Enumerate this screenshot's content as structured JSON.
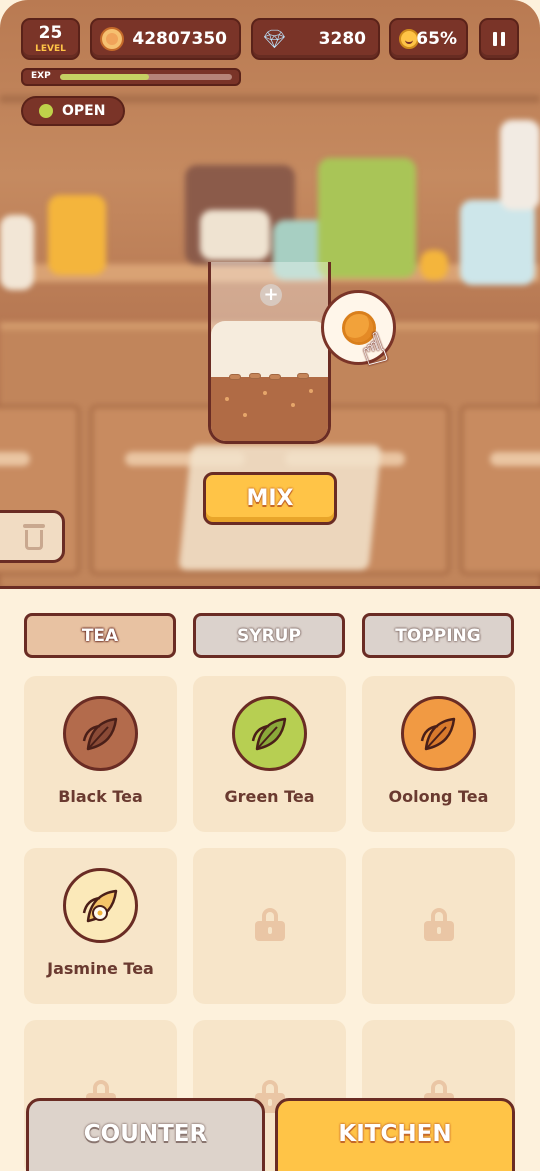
{
  "hud": {
    "level": "25",
    "level_label": "LEVEL",
    "coins": "42807350",
    "gems": "3280",
    "mood": "65%",
    "exp_label": "EXP",
    "exp_progress": 0.52
  },
  "status": {
    "open_label": "OPEN"
  },
  "station": {
    "mix_label": "MIX"
  },
  "tabs": [
    {
      "label": "TEA",
      "active": true
    },
    {
      "label": "SYRUP",
      "active": false
    },
    {
      "label": "TOPPING",
      "active": false
    }
  ],
  "ingredients": [
    {
      "label": "Black Tea",
      "icon": "black-tea-leaf-icon",
      "color": "#b36b4c",
      "locked": false
    },
    {
      "label": "Green Tea",
      "icon": "green-tea-leaf-icon",
      "color": "#b7cf52",
      "locked": false
    },
    {
      "label": "Oolong Tea",
      "icon": "oolong-tea-leaf-icon",
      "color": "#f19a43",
      "locked": false
    },
    {
      "label": "Jasmine Tea",
      "icon": "jasmine-tea-leaf-icon",
      "color": "#fbe9b9",
      "locked": false
    },
    {
      "label": "",
      "icon": "lock-icon",
      "locked": true
    },
    {
      "label": "",
      "icon": "lock-icon",
      "locked": true
    },
    {
      "label": "",
      "icon": "lock-icon",
      "locked": true
    },
    {
      "label": "",
      "icon": "lock-icon",
      "locked": true
    },
    {
      "label": "",
      "icon": "lock-icon",
      "locked": true
    }
  ],
  "nav": {
    "counter_label": "COUNTER",
    "kitchen_label": "KITCHEN"
  },
  "colors": {
    "accent": "#ffc447",
    "dark": "#7a3428",
    "panel": "#fdf1dc"
  }
}
